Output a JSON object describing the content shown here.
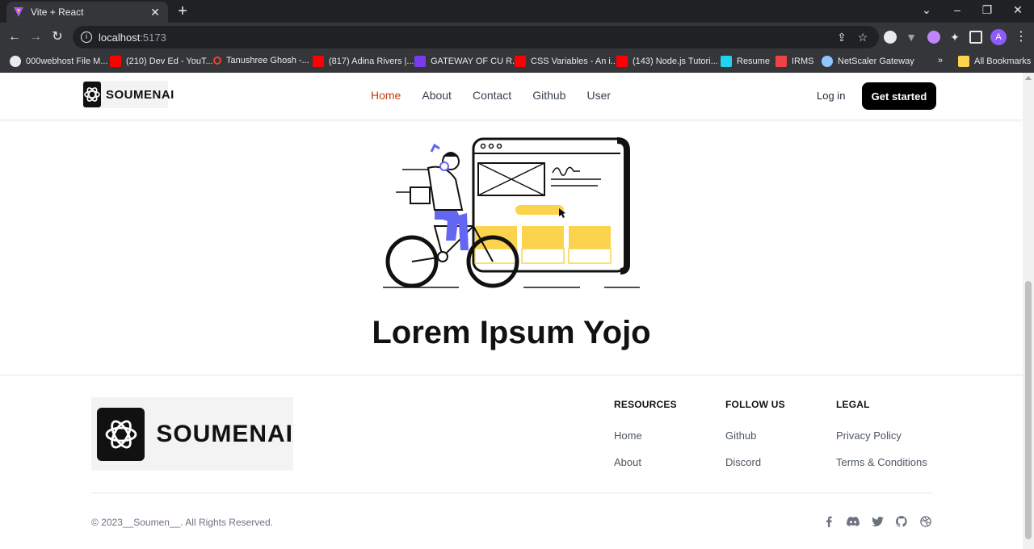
{
  "browser": {
    "tab_title": "Vite + React",
    "url_host": "localhost",
    "url_port": ":5173",
    "avatar_letter": "A",
    "bookmarks": [
      {
        "label": "000webhost File M...",
        "color": "#e8eaed"
      },
      {
        "label": "(210) Dev Ed - YouT...",
        "color": "#ff0000"
      },
      {
        "label": "Tanushree Ghosh -...",
        "color": "#ea4335"
      },
      {
        "label": "(817) Adina Rivers |...",
        "color": "#ff0000"
      },
      {
        "label": "GATEWAY OF CU R...",
        "color": "#7c3aed"
      },
      {
        "label": "CSS Variables - An i...",
        "color": "#ff0000"
      },
      {
        "label": "(143) Node.js Tutori...",
        "color": "#ff0000"
      },
      {
        "label": "Resume",
        "color": "#22d3ee"
      },
      {
        "label": "IRMS",
        "color": "#ef4444"
      },
      {
        "label": "NetScaler Gateway",
        "color": "#93c5fd"
      }
    ],
    "all_bookmarks": "All Bookmarks",
    "overflow": "»"
  },
  "header": {
    "logo_text": "SOUMENAI",
    "nav": [
      "Home",
      "About",
      "Contact",
      "Github",
      "User"
    ],
    "login": "Log in",
    "cta": "Get started"
  },
  "hero": {
    "title": "Lorem Ipsum Yojo",
    "accent_yellow": "#fcd34d",
    "accent_blue": "#6366f1"
  },
  "footer": {
    "logo_text": "SOUMENAI",
    "columns": [
      {
        "heading": "RESOURCES",
        "links": [
          "Home",
          "About"
        ]
      },
      {
        "heading": "FOLLOW US",
        "links": [
          "Github",
          "Discord"
        ]
      },
      {
        "heading": "LEGAL",
        "links": [
          "Privacy Policy",
          "Terms & Conditions"
        ]
      }
    ],
    "copyright": "© 2023__Soumen__. All Rights Reserved.",
    "social_icons": [
      "facebook-icon",
      "discord-icon",
      "twitter-icon",
      "github-icon",
      "dribbble-icon"
    ]
  }
}
